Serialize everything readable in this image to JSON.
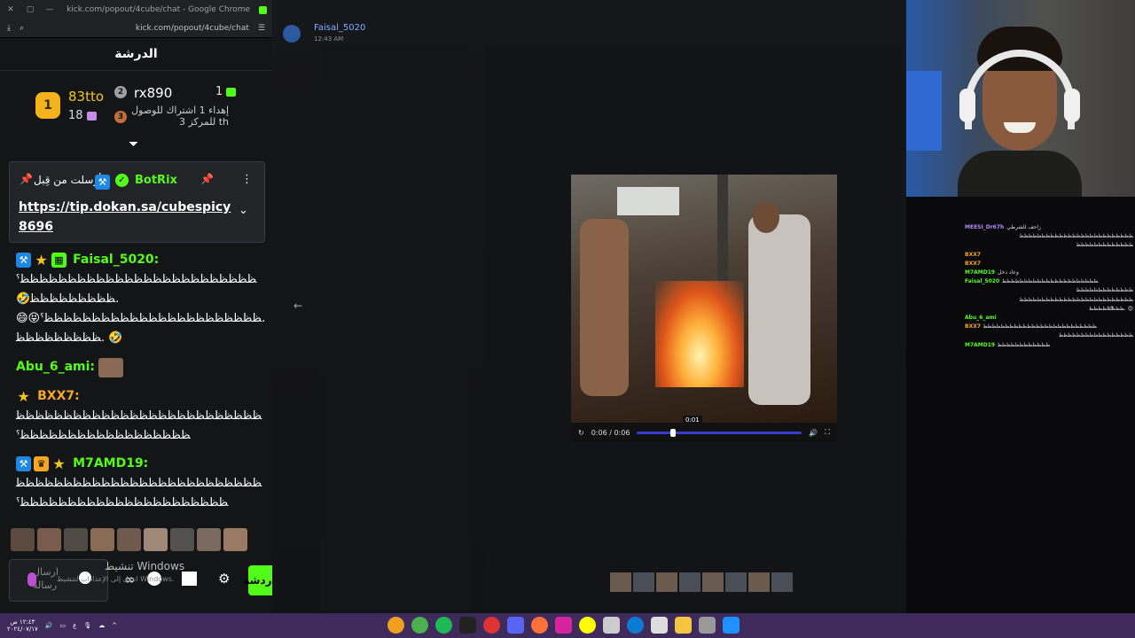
{
  "chrome": {
    "title": "kick.com/popout/4cube/chat - Google Chrome",
    "url": "kick.com/popout/4cube/chat"
  },
  "chat": {
    "title": "الدرشة",
    "leaderboard": {
      "first": {
        "name": "83tto",
        "rank": "1",
        "count": "18"
      },
      "second": {
        "name": "rx890",
        "rank": "2",
        "count": "1"
      },
      "third": {
        "rank": "3",
        "text_line1": "إهداء 1 اشتراك للوصول",
        "text_line2": "للمركز 3 th"
      }
    },
    "pinned": {
      "sender": "BotRix",
      "sent_by": "أرسلت من قِبل",
      "link_line1": "https://tip.dokan.sa/cubespicy",
      "link_line2": "8696"
    },
    "messages": [
      {
        "user": "Faisal_5020:",
        "color": "#53fc18",
        "lines": [
          "ˁﻈﻈﻈﻈﻈﻈﻈﻈﻈﻈﻈﻈﻈﻈﻈﻈﻈﻈﻈﻈﻈﻈﻈﻈﻈ",
          "🤣ﻈﻈﻈﻈﻈﻈﻈﻈﻈ.",
          "😄😝ˁﻈﻈﻈﻈﻈﻈﻈﻈﻈﻈﻈﻈﻈﻈﻈﻈﻈﻈﻈﻈﻈﻈﻈ.",
          "ﻈﻈﻈﻈﻈﻈﻈﻈﻈ. 🤣"
        ]
      },
      {
        "user": "Abu_6_ami:",
        "color": "#53fc18",
        "lines": []
      },
      {
        "user": "BXX7:",
        "color": "#f5a623",
        "lines": [
          "ﻈﻈﻈﻈﻈﻈﻈﻈﻈﻈﻈﻈﻈﻈﻈﻈﻈﻈﻈﻈﻈﻈﻈﻈﻈﻈ",
          "ˁﻈﻈﻈﻈﻈﻈﻈﻈﻈﻈﻈﻈﻈﻈﻈﻈﻈﻈ"
        ]
      },
      {
        "user": "M7AMD19:",
        "color": "#53fc18",
        "lines": [
          "ﻈﻈﻈﻈﻈﻈﻈﻈﻈﻈﻈﻈﻈﻈﻈﻈﻈﻈﻈﻈﻈﻈﻈﻈﻈﻈ",
          "ˁﻈﻈﻈﻈﻈﻈﻈﻈﻈﻈﻈﻈﻈﻈﻈﻈﻈﻈﻈﻈﻈﻈ"
        ]
      }
    ],
    "send_placeholder": "ارسال رسالة",
    "send_button": "دردشة",
    "windows_watermark": "تنشيط Windows",
    "windows_sub": "انتقل إلى الإعدادات لتنشيط Windows."
  },
  "discord": {
    "username": "Faisal_5020",
    "time": "12:43 AM"
  },
  "video": {
    "time_display": "0:06 / 0:06",
    "hover_time": "0:01",
    "progress": 0.2
  },
  "side_chat": [
    {
      "user": "MEESI_Dr67h",
      "color": "#b48aff",
      "text": "زاحف للشرطي"
    },
    {
      "user": "",
      "color": "#fff",
      "text": "ﻈﻈﻈﻈﻈﻈﻈﻈﻈﻈﻈﻈﻈﻈﻈﻈﻈﻈﻈﻈﻈﻈﻈﻈﻈﻈ"
    },
    {
      "user": "",
      "color": "#fff",
      "text": "ﻈﻈﻈﻈﻈﻈﻈﻈﻈﻈﻈﻈﻈ"
    },
    {
      "user": "BXX7",
      "color": "#f5a623",
      "text": ""
    },
    {
      "user": "BXX7",
      "color": "#f5a623",
      "text": ""
    },
    {
      "user": "M7AMD19",
      "color": "#53fc18",
      "text": "وعاد دخل"
    },
    {
      "user": "Faisal_5020",
      "color": "#53fc18",
      "text": "ﻈﻈﻈﻈﻈﻈﻈﻈﻈﻈﻈﻈﻈﻈﻈﻈﻈﻈﻈﻈﻈﻈ"
    },
    {
      "user": "",
      "color": "#fff",
      "text": "ﻈﻈﻈﻈﻈﻈﻈﻈﻈﻈﻈﻈﻈ"
    },
    {
      "user": "",
      "color": "#fff",
      "text": "ﻈﻈﻈﻈﻈﻈﻈﻈﻈﻈﻈﻈﻈﻈﻈﻈﻈﻈﻈﻈﻈﻈﻈﻈﻈﻈ"
    },
    {
      "user": "",
      "color": "#fff",
      "text": "ﻈﻈﻈﻈﻈﻈﻈﻈ. 😍"
    },
    {
      "user": "Abu_6_ami",
      "color": "#53fc18",
      "text": ""
    },
    {
      "user": "BXX7",
      "color": "#f5a623",
      "text": "ﻈﻈﻈﻈﻈﻈﻈﻈﻈﻈﻈﻈﻈﻈﻈﻈﻈﻈﻈﻈﻈﻈﻈﻈﻈﻈ"
    },
    {
      "user": "",
      "color": "#fff",
      "text": "ﻈﻈﻈﻈﻈﻈﻈﻈﻈﻈﻈﻈﻈﻈﻈﻈﻈ"
    },
    {
      "user": "M7AMD19",
      "color": "#53fc18",
      "text": "ﻈﻈﻈﻈﻈﻈﻈﻈﻈﻈﻈﻈ"
    }
  ],
  "taskbar": {
    "clock": "١٢:٤٣ ص",
    "date": "٢٠٢٤/٠٧/١٧"
  }
}
